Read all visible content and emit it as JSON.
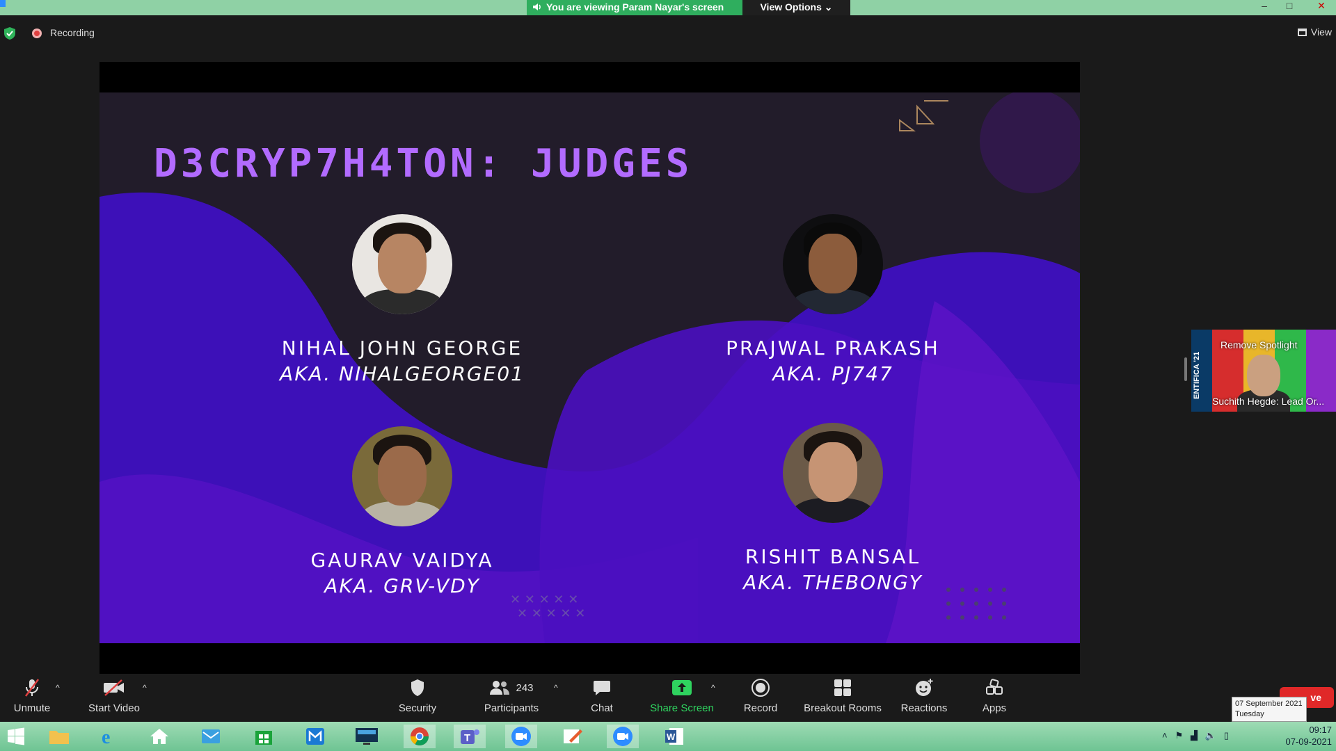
{
  "window": {
    "banner_text": "You are viewing Param Nayar's screen",
    "view_options_label": "View Options",
    "minimize": "–",
    "maximize": "□",
    "close": "✕"
  },
  "meeting": {
    "recording_label": "Recording",
    "view_label": "View"
  },
  "slide": {
    "title": "D3CRYP7H4TON: JUDGES",
    "judges": [
      {
        "name": "NIHAL JOHN GEORGE",
        "aka": "AKA. NIHALGEORGE01"
      },
      {
        "name": "PRAJWAL PRAKASH",
        "aka": "AKA. PJ747"
      },
      {
        "name": "GAURAV VAIDYA",
        "aka": "AKA. GRV-VDY"
      },
      {
        "name": "RISHIT BANSAL",
        "aka": "AKA. THEBONGY"
      }
    ]
  },
  "spotlight": {
    "remove_label": "Remove Spotlight",
    "participant": "Suchith Hegde: Lead Or...",
    "side_text": "ENTIFICA '21"
  },
  "toolbar": {
    "unmute": "Unmute",
    "start_video": "Start Video",
    "security": "Security",
    "participants": "Participants",
    "participant_count": "243",
    "chat": "Chat",
    "share_screen": "Share Screen",
    "record": "Record",
    "breakout_rooms": "Breakout Rooms",
    "reactions": "Reactions",
    "apps": "Apps",
    "leave": "ve"
  },
  "date_tooltip": {
    "date": "07 September 2021",
    "day": "Tuesday"
  },
  "taskbar": {
    "time": "09:17",
    "date": "07-09-2021"
  },
  "colors": {
    "banner_green": "#2fae5e",
    "slide_title": "#b26bff",
    "blob_purple": "#3d10b8",
    "share_green": "#2fd35f",
    "leave_red": "#e02828"
  }
}
